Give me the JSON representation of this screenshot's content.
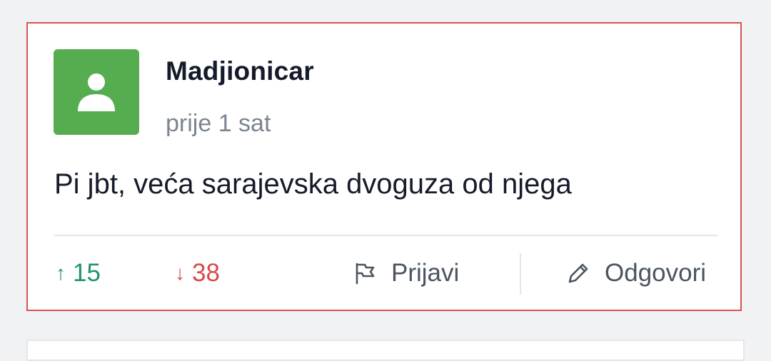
{
  "comment": {
    "username": "Madjionicar",
    "timestamp": "prije 1 sat",
    "text": "Pi jbt, veća sarajevska dvoguza od njega",
    "avatar_icon": "user-icon",
    "avatar_color": "#55ad50",
    "highlight_border_color": "#d9534f"
  },
  "actions": {
    "upvote_arrow": "↑",
    "upvote_count": "15",
    "downvote_arrow": "↓",
    "downvote_count": "38",
    "report_label": "Prijavi",
    "report_icon": "flag-icon",
    "reply_label": "Odgovori",
    "reply_icon": "pencil-icon",
    "upvote_color": "#1f9566",
    "downvote_color": "#d84a4a"
  }
}
